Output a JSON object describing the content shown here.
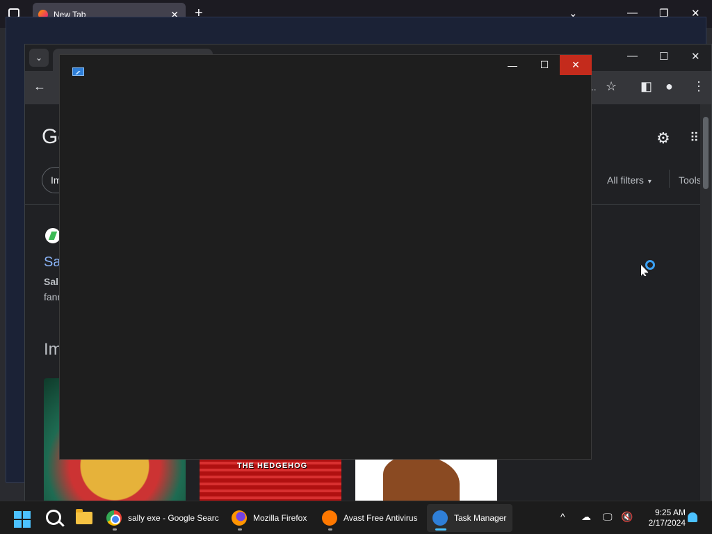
{
  "firefox": {
    "tab_title": "New Tab",
    "new_tab_label": "+",
    "tab_close": "✕",
    "controls": {
      "tabs_list": "⌄",
      "minimize": "—",
      "maximize": "❐",
      "close": "✕"
    }
  },
  "chrome": {
    "tab_list_label": "⌄",
    "controls": {
      "minimize": "—",
      "maximize": "☐",
      "close": "✕"
    },
    "toolbar": {
      "back": "←",
      "ellipsis": "...",
      "star": "☆",
      "side_panel": "◧",
      "profile": "●",
      "menu": "⋮"
    },
    "google": {
      "logo_fragment": "Go",
      "settings_icon": "⚙",
      "apps_icon": "⠿",
      "chip_fragment": "Im",
      "all_filters": "All filters",
      "caret": "▾",
      "tools": "Tools",
      "result_title_fragment": "Sa",
      "result_snippet1_fragment": "Sall",
      "result_snippet2_fragment": "fann",
      "images_heading_fragment": "Im",
      "image2_text": "THE HEDGEHOG"
    }
  },
  "task_manager": {
    "controls": {
      "minimize": "—",
      "maximize": "☐",
      "close": "✕"
    }
  },
  "taskbar": {
    "apps": [
      {
        "label": "sally exe - Google Searc",
        "icon": "chrome-icon",
        "active": false
      },
      {
        "label": "Mozilla Firefox",
        "icon": "firefox-icon",
        "active": false
      },
      {
        "label": "Avast Free Antivirus",
        "icon": "avast-icon",
        "active": false
      },
      {
        "label": "Task Manager",
        "icon": "task-manager-icon",
        "active": true
      }
    ],
    "tray": {
      "chevron": "^",
      "onedrive": "☁",
      "network": "🖵",
      "volume": "🔇",
      "time": "9:25 AM",
      "date": "2/17/2024"
    }
  },
  "colors": {
    "accent": "#4cc2ff",
    "close_red": "#c42b1c",
    "link_blue": "#8ab4f8"
  }
}
